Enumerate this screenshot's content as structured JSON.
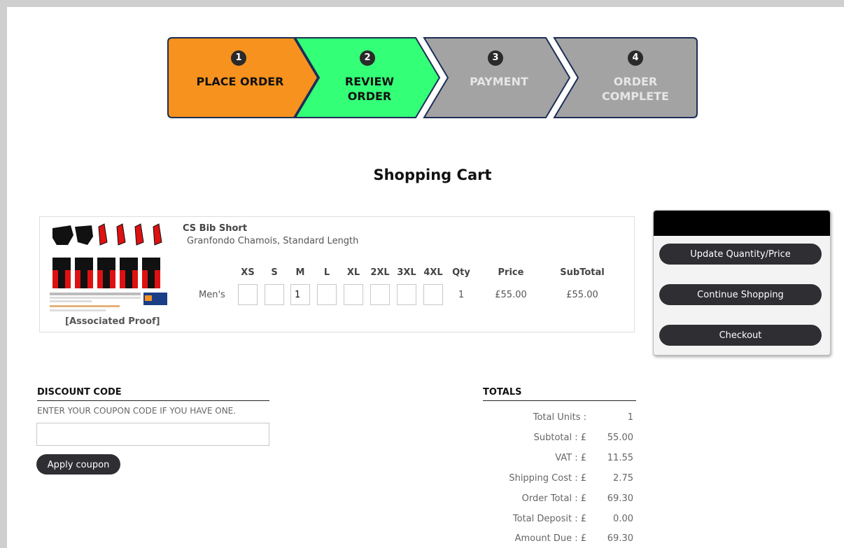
{
  "steps": [
    {
      "number": "1",
      "label_line1": "PLACE ORDER",
      "label_line2": "",
      "color": "#F7921E",
      "text_color": "#111111"
    },
    {
      "number": "2",
      "label_line1": "REVIEW",
      "label_line2": "ORDER",
      "color": "#33FF77",
      "text_color": "#111111"
    },
    {
      "number": "3",
      "label_line1": "PAYMENT",
      "label_line2": "",
      "color": "#A3A3A3",
      "text_color": "#E6E6E6"
    },
    {
      "number": "4",
      "label_line1": "ORDER",
      "label_line2": "COMPLETE",
      "color": "#A3A3A3",
      "text_color": "#E6E6E6"
    }
  ],
  "page_title": "Shopping Cart",
  "item": {
    "name": "CS Bib Short",
    "description": "Granfondo Chamois, Standard Length",
    "proof_link": "[Associated Proof]",
    "sizes": [
      "XS",
      "S",
      "M",
      "L",
      "XL",
      "2XL",
      "3XL",
      "4XL"
    ],
    "qty_header": "Qty",
    "price_header": "Price",
    "subtotal_header": "SubTotal",
    "row_label": "Men's",
    "size_values": [
      "",
      "",
      "1",
      "",
      "",
      "",
      "",
      ""
    ],
    "qty": "1",
    "price": "£55.00",
    "subtotal": "£55.00"
  },
  "actions": {
    "update": "Update Quantity/Price",
    "continue": "Continue Shopping",
    "checkout": "Checkout"
  },
  "discount": {
    "title": "DISCOUNT CODE",
    "help": "ENTER YOUR COUPON CODE IF YOU HAVE ONE.",
    "input_value": "",
    "apply": "Apply coupon"
  },
  "totals": {
    "title": "TOTALS",
    "rows": [
      {
        "label": "Total Units :",
        "value": "1"
      },
      {
        "label": "Subtotal : £",
        "value": "55.00"
      },
      {
        "label": "VAT : £",
        "value": "11.55"
      },
      {
        "label": "Shipping Cost : £",
        "value": "2.75"
      },
      {
        "label": "Order Total : £",
        "value": "69.30"
      },
      {
        "label": "Total Deposit : £",
        "value": "0.00"
      },
      {
        "label": "Amount Due : £",
        "value": "69.30"
      }
    ]
  }
}
